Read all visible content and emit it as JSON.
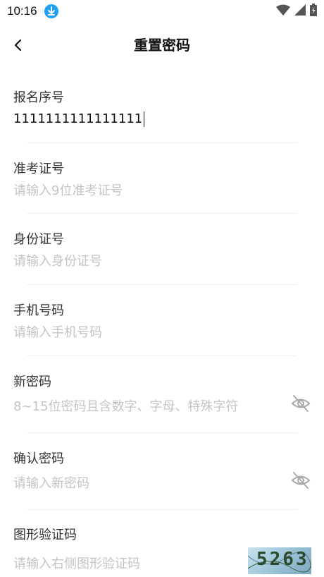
{
  "status_bar": {
    "time": "10:16"
  },
  "header": {
    "title": "重置密码"
  },
  "form": {
    "registration_number": {
      "label": "报名序号",
      "value": "1111111111111111"
    },
    "admission_number": {
      "label": "准考证号",
      "placeholder": "请输入9位准考证号"
    },
    "id_number": {
      "label": "身份证号",
      "placeholder": "请输入身份证号"
    },
    "phone_number": {
      "label": "手机号码",
      "placeholder": "请输入手机号码"
    },
    "new_password": {
      "label": "新密码",
      "placeholder": "8~15位密码且含数字、字母、特殊字符"
    },
    "confirm_password": {
      "label": "确认密码",
      "placeholder": "请输入新密码"
    },
    "captcha": {
      "label": "图形验证码",
      "placeholder": "请输入右侧图形验证码",
      "image_text": "5263"
    }
  },
  "icons": {
    "back": "chevron-left-icon",
    "download": "download-icon",
    "wifi": "wifi-icon",
    "signal": "signal-icon",
    "battery": "battery-icon",
    "visibility": "eye-off-icon"
  },
  "colors": {
    "accent": "#1da1f2",
    "placeholder": "#c4c4c4",
    "label": "#333333"
  }
}
